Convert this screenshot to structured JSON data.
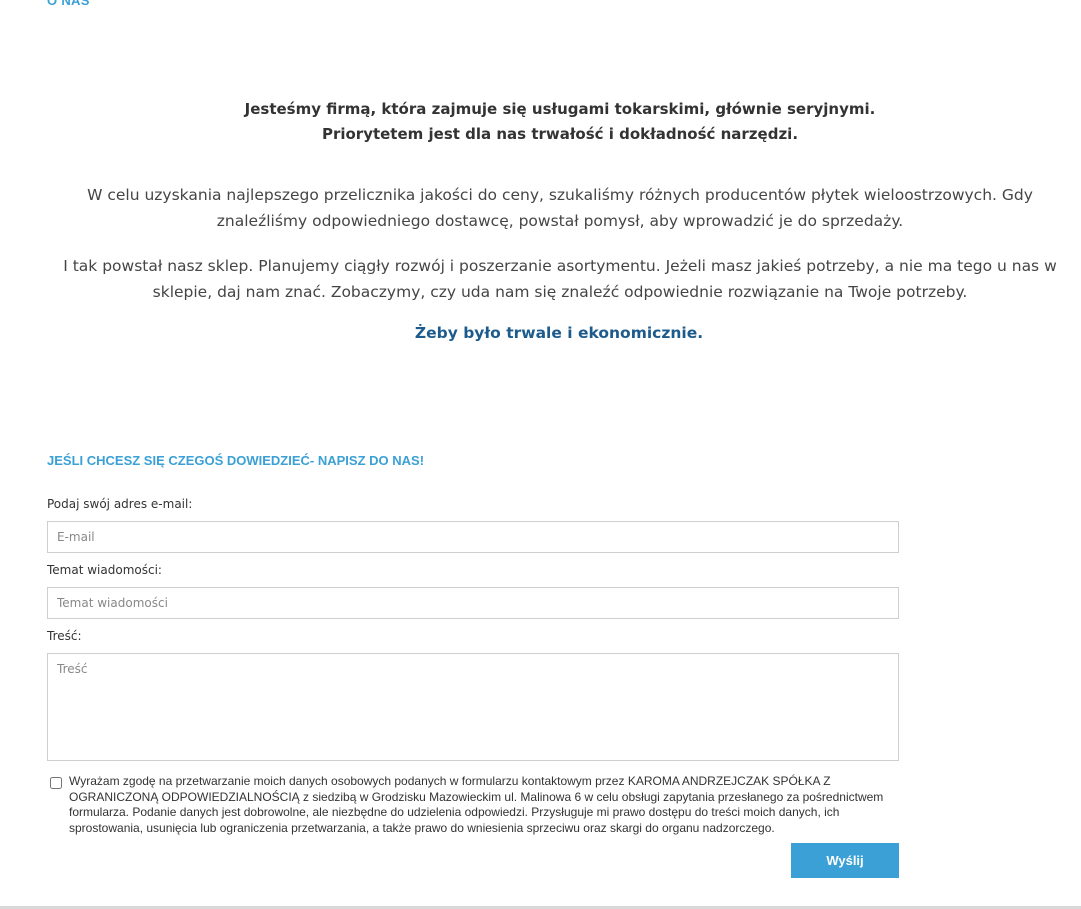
{
  "about": {
    "section_label": "O NAS",
    "lead_line_1": "Jesteśmy firmą, która zajmuje się usługami tokarskimi, głównie seryjnymi.",
    "lead_line_2": "Priorytetem jest dla nas trwałość i dokładność narzędzi.",
    "paragraph_1": "W celu uzyskania najlepszego przelicznika jakości do ceny, szukaliśmy różnych producentów płytek wieloostrzowych. Gdy znaleźliśmy odpowiedniego dostawcę, powstał pomysł, aby wprowadzić je do sprzedaży.",
    "paragraph_2": "I tak powstał nasz sklep. Planujemy ciągły rozwój i poszerzanie asortymentu. Jeżeli masz jakieś potrzeby, a nie ma tego u nas w sklepie, daj nam znać. Zobaczymy, czy uda nam się znaleźć odpowiednie rozwiązanie na Twoje potrzeby.",
    "tagline": "Żeby było trwale i ekonomicznie."
  },
  "contact_form": {
    "heading": "JEŚLI CHCESZ SIĘ CZEGOŚ DOWIEDZIEĆ- NAPISZ DO NAS!",
    "email_label": "Podaj swój adres e-mail:",
    "email_placeholder": "E-mail",
    "email_value": "",
    "subject_label": "Temat wiadomości:",
    "subject_placeholder": "Temat wiadomości",
    "subject_value": "",
    "message_label": "Treść:",
    "message_placeholder": "Treść",
    "message_value": "",
    "consent_checked": false,
    "consent_text": "Wyrażam zgodę na przetwarzanie moich danych osobowych podanych w formularzu kontaktowym przez KAROMA ANDRZEJCZAK SPÓŁKA Z OGRANICZONĄ ODPOWIEDZIALNOŚCIĄ z siedzibą w Grodzisku Mazowieckim ul. Malinowa 6 w celu obsługi zapytania przesłanego za pośrednictwem formularza. Podanie danych jest dobrowolne, ale niezbędne do udzielenia odpowiedzi. Przysługuje mi prawo dostępu do treści moich danych, ich sprostowania, usunięcia lub ograniczenia przetwarzania, a także prawo do wniesienia sprzeciwu oraz skargi do organu nadzorczego.",
    "submit_label": "Wyślij"
  },
  "colors": {
    "accent": "#3aa0d6",
    "tagline": "#1d5b8c",
    "text": "#333333"
  }
}
